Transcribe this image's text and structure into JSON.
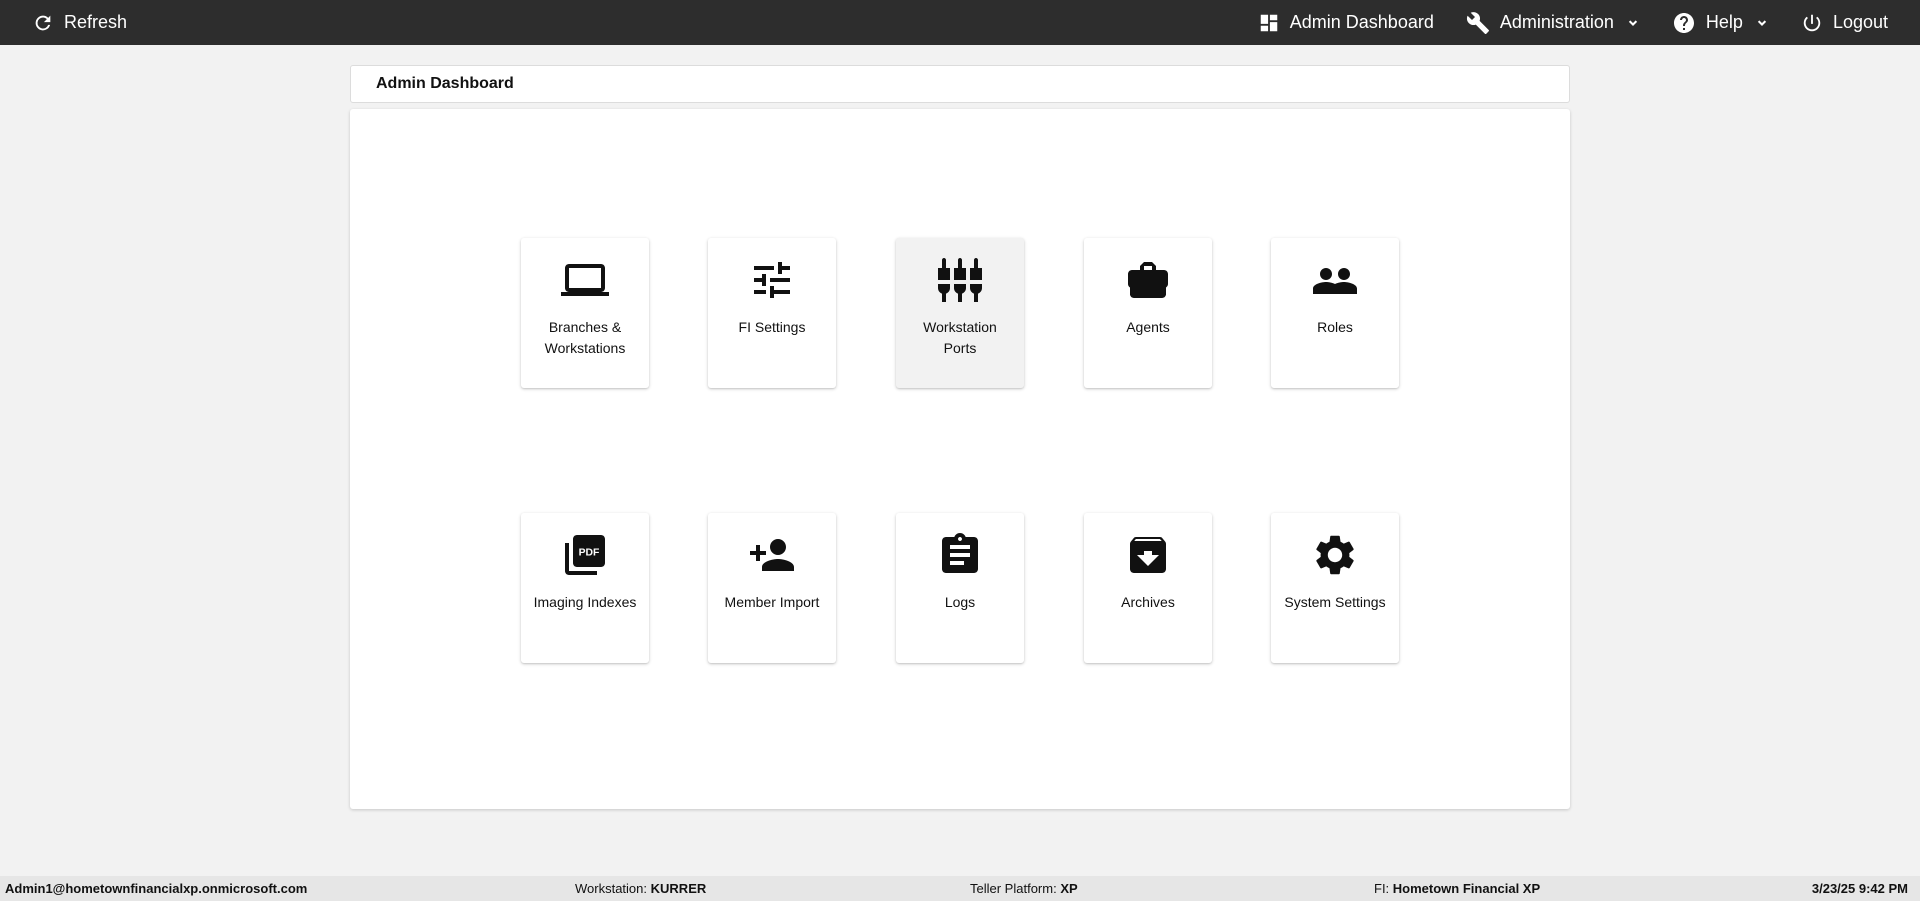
{
  "topbar": {
    "refresh_label": "Refresh",
    "admin_dashboard_label": "Admin Dashboard",
    "administration_label": "Administration",
    "help_label": "Help",
    "logout_label": "Logout"
  },
  "page": {
    "title": "Admin Dashboard"
  },
  "tiles": [
    {
      "label": "Branches & Workstations",
      "icon": "laptop-icon"
    },
    {
      "label": "FI Settings",
      "icon": "tune-icon"
    },
    {
      "label": "Workstation Ports",
      "icon": "settings-input-component-icon"
    },
    {
      "label": "Agents",
      "icon": "briefcase-icon"
    },
    {
      "label": "Roles",
      "icon": "people-icon"
    },
    {
      "label": "Imaging Indexes",
      "icon": "pdf-icon"
    },
    {
      "label": "Member Import",
      "icon": "person-add-icon"
    },
    {
      "label": "Logs",
      "icon": "clipboard-icon"
    },
    {
      "label": "Archives",
      "icon": "archive-icon"
    },
    {
      "label": "System Settings",
      "icon": "gear-icon"
    }
  ],
  "statusbar": {
    "user": "Admin1@hometownfinancialxp.onmicrosoft.com",
    "workstation_label": "Workstation:",
    "workstation_value": "KURRER",
    "platform_label": "Teller Platform:",
    "platform_value": "XP",
    "fi_label": "FI:",
    "fi_value": "Hometown Financial XP",
    "datetime": "3/23/25 9:42 PM"
  },
  "colors": {
    "topbar_bg": "#2d2d2d",
    "page_bg": "#f2f2f2",
    "statusbar_bg": "#e6e6e6"
  }
}
